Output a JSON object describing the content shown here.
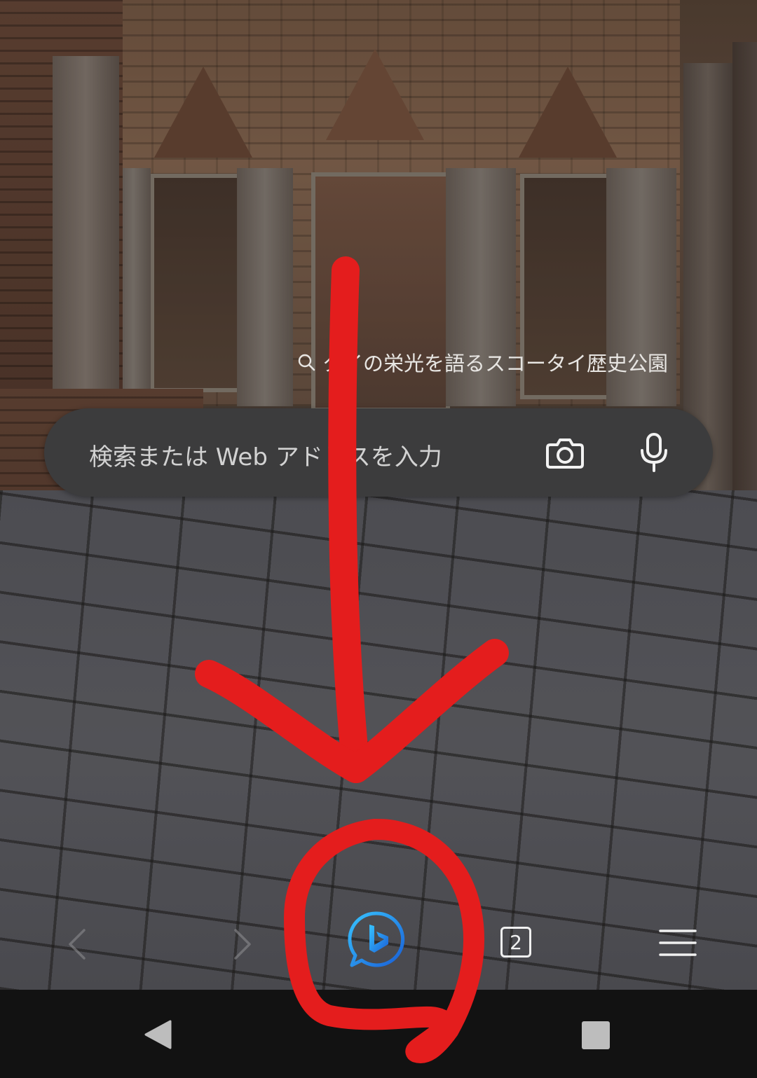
{
  "wallpaper": {
    "caption": "タイの栄光を語るスコータイ歴史公園",
    "caption_icon": "search-icon"
  },
  "search_bar": {
    "placeholder": "検索または Web アドレスを入力",
    "camera_icon": "camera-icon",
    "mic_icon": "microphone-icon"
  },
  "toolbar": {
    "back_icon": "arrow-left-icon",
    "forward_icon": "arrow-right-icon",
    "copilot_icon": "copilot-chat-icon",
    "copilot_color": "#1f8fe8",
    "tab_count": "2",
    "menu_icon": "hamburger-menu-icon"
  },
  "system_nav": {
    "back_icon": "nav-back-triangle-icon",
    "recents_icon": "nav-recents-square-icon"
  },
  "annotation": {
    "color": "#e41d1d",
    "shapes": [
      "arrow-down",
      "circle"
    ]
  }
}
